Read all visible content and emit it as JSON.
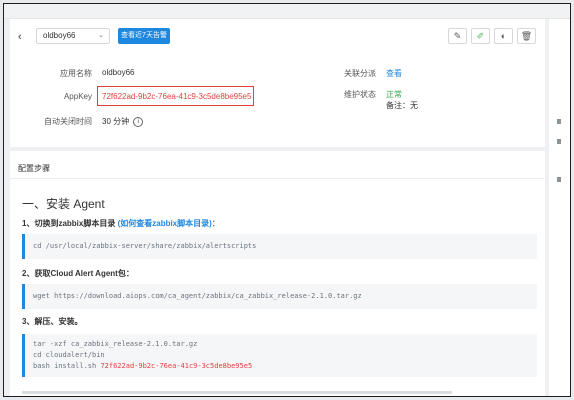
{
  "header": {
    "back_icon": "chevron-left-icon",
    "app_select": "oldboy66",
    "alarm_button": "查看近7天告警",
    "action_icons": [
      "pencil-icon",
      "brush-icon",
      "toggle-icon",
      "trash-icon"
    ]
  },
  "details": {
    "app_name_label": "应用名称",
    "app_name_value": "oldboy66",
    "appkey_label": "AppKey",
    "appkey_value": "72f622ad-9b2c-76ea-41c9-3c5de8be95e5",
    "auto_close_label": "自动关闭时间",
    "auto_close_value": "30 分钟",
    "group_label": "关联分派",
    "group_value": "查看",
    "status_label": "维护状态",
    "status_value": "正常",
    "remark": "备注：无"
  },
  "config": {
    "section_title": "配置步骤",
    "heading": "一、安装 Agent",
    "step1": "1、切换到zabbix脚本目录",
    "step1_link": "(如何查看zabbix脚本目录)：",
    "step1_code": "cd /usr/local/zabbix-server/share/zabbix/alertscripts",
    "step2": "2、获取Cloud Alert Agent包：",
    "step2_code": "wget https://download.aiops.com/ca_agent/zabbix/ca_zabbix_release-2.1.0.tar.gz",
    "step3": "3、解压、安装。",
    "step3_code1": "tar -xzf ca_zabbix_release-2.1.0.tar.gz",
    "step3_code2": "cd cloudalert/bin",
    "step3_code3_prefix": "bash install.sh ",
    "step3_code3_key": "72f622ad-9b2c-76ea-41c9-3c5de8be95e5"
  },
  "colors": {
    "accent": "#1e87e0",
    "danger": "#e0403f",
    "success": "#3aa64a"
  }
}
